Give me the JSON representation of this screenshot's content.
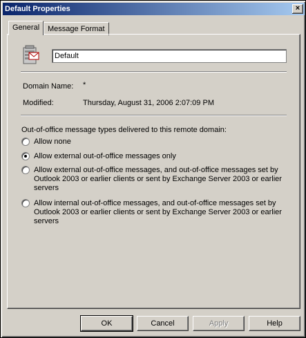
{
  "window": {
    "title": "Default Properties",
    "close_glyph": "×"
  },
  "tabs": [
    {
      "label": "General",
      "active": true
    },
    {
      "label": "Message Format",
      "active": false
    }
  ],
  "general": {
    "name_value": "Default",
    "domain_name_label": "Domain Name:",
    "domain_name_value": "*",
    "modified_label": "Modified:",
    "modified_value": "Thursday, August 31, 2006 2:07:09 PM",
    "ooo_heading": "Out-of-office message types delivered to this remote domain:",
    "ooo_options": [
      {
        "lines": [
          "Allow none"
        ],
        "selected": false
      },
      {
        "lines": [
          "Allow external out-of-office messages only"
        ],
        "selected": true
      },
      {
        "lines": [
          "Allow external out-of-office messages, and out-of-office messages set by",
          "Outlook 2003 or earlier clients or sent by Exchange Server 2003 or earlier",
          "servers"
        ],
        "selected": false
      },
      {
        "lines": [
          "Allow internal out-of-office messages, and out-of-office messages set by",
          "Outlook 2003 or earlier clients or sent by Exchange Server 2003 or earlier",
          "servers"
        ],
        "selected": false
      }
    ]
  },
  "buttons": {
    "ok": "OK",
    "cancel": "Cancel",
    "apply": "Apply",
    "help": "Help"
  },
  "icons": {
    "domain": "server-mail-icon",
    "close": "close-icon"
  },
  "colors": {
    "title_start": "#0a246a",
    "title_end": "#a6caf0",
    "face": "#d4d0c8"
  }
}
